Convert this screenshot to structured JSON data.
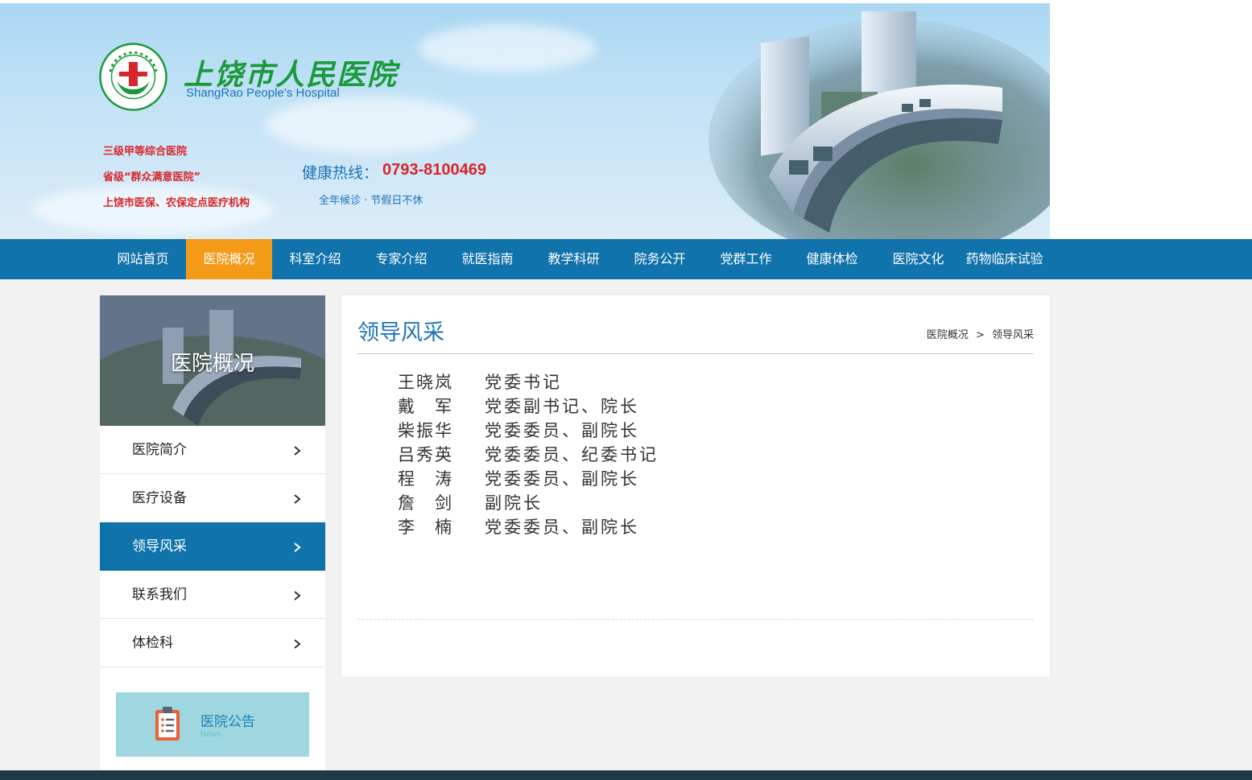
{
  "header": {
    "hospital_name_cn": "上饶市人民医院",
    "hospital_name_en": "ShangRao People’s Hospital",
    "taglines": [
      "三级甲等综合医院",
      "省级“群众满意医院”",
      "上饶市医保、农保定点医疗机构"
    ],
    "hotline_label": "健康热线：",
    "hotline_number": "0793-8100469",
    "hotline_sub": "全年候诊 · 节假日不休"
  },
  "nav": {
    "items": [
      {
        "label": "网站首页"
      },
      {
        "label": "医院概况",
        "active": true
      },
      {
        "label": "科室介绍"
      },
      {
        "label": "专家介绍"
      },
      {
        "label": "就医指南"
      },
      {
        "label": "教学科研"
      },
      {
        "label": "院务公开"
      },
      {
        "label": "党群工作"
      },
      {
        "label": "健康体检"
      },
      {
        "label": "医院文化"
      },
      {
        "label": "药物临床试验"
      }
    ]
  },
  "sidebar": {
    "banner_title": "医院概况",
    "items": [
      {
        "label": "医院简介"
      },
      {
        "label": "医疗设备"
      },
      {
        "label": "领导风采",
        "active": true
      },
      {
        "label": "联系我们"
      },
      {
        "label": "体检科"
      }
    ],
    "notice": {
      "title": "医院公告",
      "subtitle": "News"
    }
  },
  "main": {
    "title": "领导风采",
    "breadcrumb": {
      "parent": "医院概况",
      "separator": ">",
      "current": "领导风采"
    },
    "leaders": [
      {
        "name": "王晓岚",
        "role": "党委书记"
      },
      {
        "name": "戴　军",
        "role": "党委副书记、院长"
      },
      {
        "name": "柴振华",
        "role": "党委委员、副院长"
      },
      {
        "name": "吕秀英",
        "role": "党委委员、纪委书记"
      },
      {
        "name": "程　涛",
        "role": "党委委员、副院长"
      },
      {
        "name": "詹　剑",
        "role": "副院长"
      },
      {
        "name": "李　楠",
        "role": "党委委员、副院长"
      }
    ]
  },
  "colors": {
    "nav_bg": "#1173ac",
    "nav_active": "#f39a18",
    "accent_blue": "#1d73b8",
    "tagline_red": "#d7262c",
    "logo_green": "#1a9a3a",
    "notice_bg": "#9ed7df"
  },
  "icons": {
    "logo": "hospital-seal-icon",
    "chevron": "chevron-right-icon",
    "notice": "clipboard-icon"
  }
}
